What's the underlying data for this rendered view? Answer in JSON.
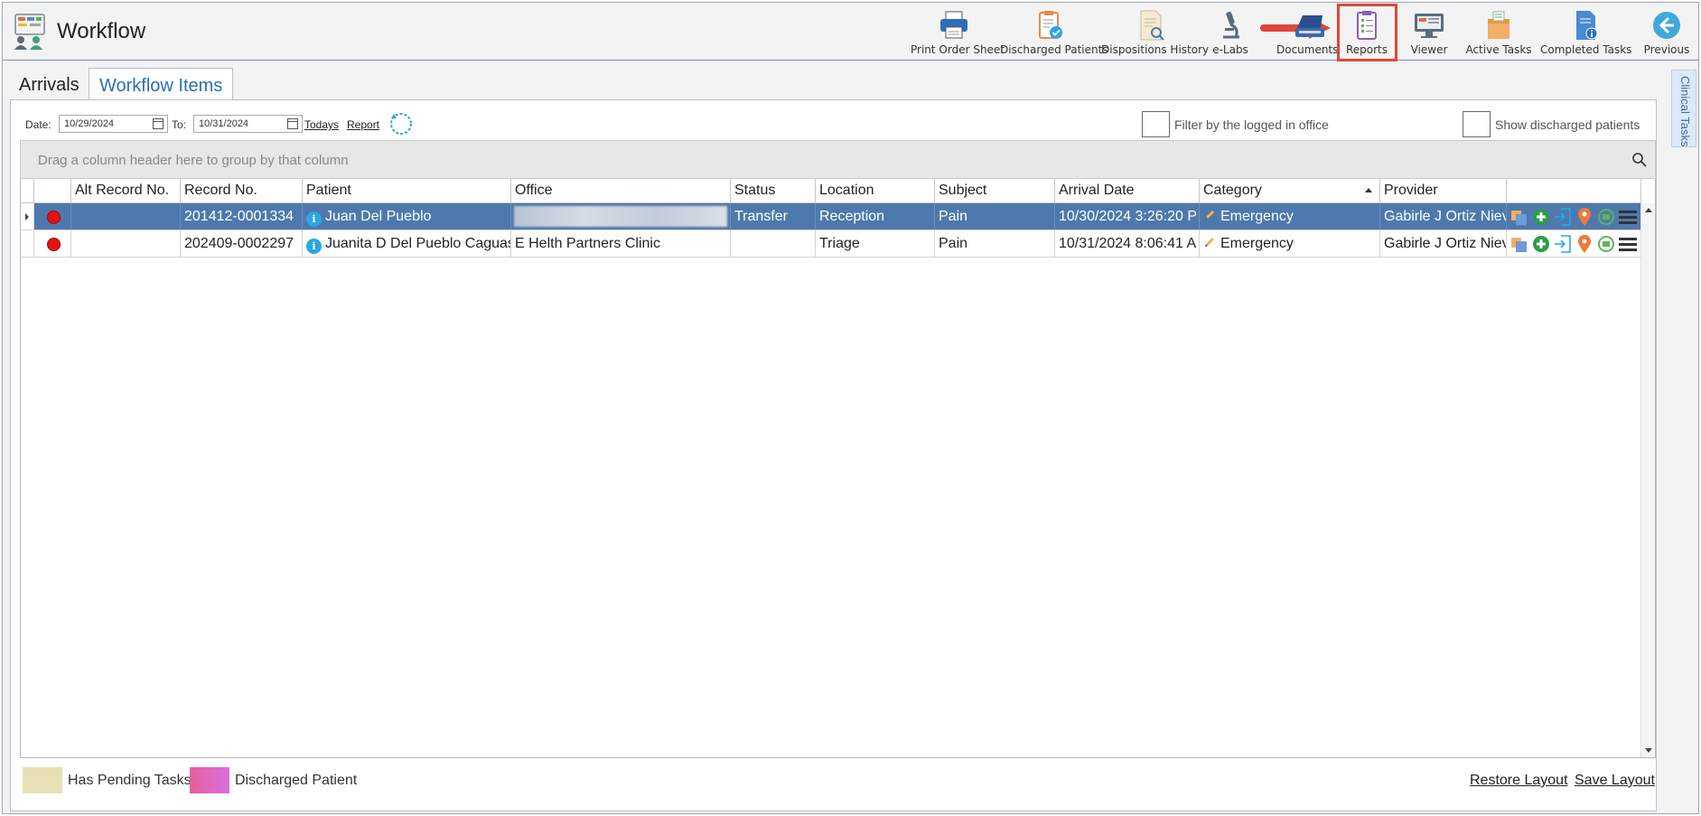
{
  "app": {
    "title": "Workflow"
  },
  "toolbar": [
    {
      "id": "print-order-sheet",
      "label": "Print Order Sheet",
      "icon": "printer-icon"
    },
    {
      "id": "discharged-patients",
      "label": "Discharged Patients",
      "icon": "clipboard-check-icon"
    },
    {
      "id": "dispositions-history",
      "label": "Dispositions History",
      "icon": "document-search-icon"
    },
    {
      "id": "e-labs",
      "label": "e-Labs",
      "icon": "microscope-icon"
    },
    {
      "id": "documents",
      "label": "Documents",
      "icon": "scanner-icon"
    },
    {
      "id": "reports",
      "label": "Reports",
      "icon": "report-clipboard-icon"
    },
    {
      "id": "viewer",
      "label": "Viewer",
      "icon": "monitor-icon"
    },
    {
      "id": "active-tasks",
      "label": "Active Tasks",
      "icon": "box-tasks-icon"
    },
    {
      "id": "completed-tasks",
      "label": "Completed Tasks",
      "icon": "document-info-icon"
    },
    {
      "id": "previous",
      "label": "Previous",
      "icon": "back-arrow-icon"
    }
  ],
  "tabs": {
    "arrivals": "Arrivals",
    "workflow_items": "Workflow Items"
  },
  "filters": {
    "date_label": "Date:",
    "date_from": "10/29/2024",
    "to_label": "To:",
    "date_to": "10/31/2024",
    "todays_link": "Todays",
    "report_link": "Report",
    "filter_office_label": "Filter by the logged in office",
    "show_discharged_label": "Show discharged patients"
  },
  "grid": {
    "group_hint": "Drag a column header here to group by that column",
    "columns": [
      "Alt Record No.",
      "Record No.",
      "Patient",
      "Office",
      "Status",
      "Location",
      "Subject",
      "Arrival Date",
      "Category",
      "Provider"
    ],
    "rows": [
      {
        "alt_record_no": "",
        "record_no": "201412-0001334",
        "patient": "Juan Del Pueblo",
        "office": "",
        "status": "Transfer",
        "location": "Reception",
        "subject": "Pain",
        "arrival_date": "10/30/2024 3:26:20 P",
        "category": "Emergency",
        "provider": "Gabirle J Ortiz Nieve",
        "selected": true
      },
      {
        "alt_record_no": "",
        "record_no": "202409-0002297",
        "patient": "Juanita D Del Pueblo Caguas",
        "office": "E Helth Partners Clinic",
        "status": "",
        "location": "Triage",
        "subject": "Pain",
        "arrival_date": "10/31/2024 8:06:41 A",
        "category": "Emergency",
        "provider": "Gabirle J Ortiz Nieve",
        "selected": false
      }
    ]
  },
  "legend": {
    "pending": "Has Pending Tasks",
    "discharged": "Discharged Patient",
    "pending_color": "#e8dfb5",
    "discharged_color": "#e6609a"
  },
  "footer": {
    "restore_layout": "Restore Layout",
    "save_layout": "Save Layout"
  },
  "side_panel": {
    "label": "Clinical Tasks"
  },
  "colors": {
    "selection": "#4e79ad",
    "link_blue": "#2a6fb5",
    "highlight_red": "#e0463a",
    "status_dot": "#e3140f"
  }
}
